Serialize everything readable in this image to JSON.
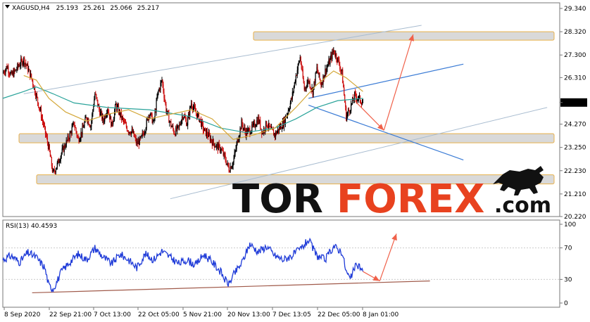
{
  "chart_data": [
    {
      "type": "candlestick",
      "header": {
        "symbol": "XAGUSD,H4",
        "open": "25.193",
        "high": "25.261",
        "low": "25.066",
        "close": "25.217"
      },
      "current_price_label": "25.217",
      "ylim": [
        20.22,
        29.34
      ],
      "y_ticks": [
        "29.340",
        "28.320",
        "27.300",
        "26.310",
        "25.217",
        "24.270",
        "23.250",
        "22.230",
        "21.210",
        "20.220"
      ],
      "x_ticks": [
        "8 Sep 2020",
        "22 Sep 21:00",
        "7 Oct 13:00",
        "22 Oct 05:00",
        "5 Nov 21:00",
        "20 Nov 13:00",
        "7 Dec 13:05",
        "22 Dec 05:00",
        "8 Jan 01:00"
      ],
      "zones": [
        {
          "low": 27.95,
          "high": 28.32
        },
        {
          "low": 23.45,
          "high": 23.85
        },
        {
          "low": 21.65,
          "high": 22.05
        }
      ],
      "price_path": [
        [
          0,
          26.5
        ],
        [
          1,
          26.8
        ],
        [
          2,
          26.4
        ],
        [
          3,
          26.6
        ],
        [
          4,
          26.9
        ],
        [
          5,
          27.1
        ],
        [
          6,
          26.7
        ],
        [
          7,
          26.2
        ],
        [
          8,
          25.5
        ],
        [
          9,
          24.8
        ],
        [
          10,
          24.0
        ],
        [
          11,
          23.2
        ],
        [
          12,
          22.1
        ],
        [
          13,
          22.5
        ],
        [
          14,
          23.0
        ],
        [
          15,
          23.4
        ],
        [
          16,
          23.8
        ],
        [
          17,
          24.3
        ],
        [
          18,
          23.6
        ],
        [
          19,
          24.0
        ],
        [
          20,
          24.6
        ],
        [
          21,
          24.2
        ],
        [
          22,
          25.6
        ],
        [
          23,
          24.9
        ],
        [
          24,
          24.4
        ],
        [
          25,
          25.0
        ],
        [
          26,
          24.2
        ],
        [
          27,
          25.1
        ],
        [
          28,
          24.7
        ],
        [
          29,
          24.3
        ],
        [
          30,
          24.0
        ],
        [
          31,
          23.9
        ],
        [
          32,
          23.4
        ],
        [
          33,
          23.6
        ],
        [
          34,
          24.1
        ],
        [
          35,
          24.8
        ],
        [
          36,
          24.3
        ],
        [
          37,
          25.6
        ],
        [
          38,
          26.2
        ],
        [
          39,
          24.9
        ],
        [
          40,
          24.3
        ],
        [
          41,
          23.9
        ],
        [
          42,
          24.1
        ],
        [
          43,
          24.7
        ],
        [
          44,
          24.3
        ],
        [
          45,
          25.2
        ],
        [
          46,
          24.8
        ],
        [
          47,
          24.5
        ],
        [
          48,
          24.0
        ],
        [
          49,
          23.8
        ],
        [
          50,
          23.5
        ],
        [
          51,
          23.3
        ],
        [
          52,
          23.2
        ],
        [
          53,
          22.8
        ],
        [
          54,
          22.3
        ],
        [
          55,
          22.6
        ],
        [
          56,
          23.5
        ],
        [
          57,
          24.3
        ],
        [
          58,
          23.9
        ],
        [
          59,
          24.0
        ],
        [
          60,
          24.2
        ],
        [
          61,
          24.5
        ],
        [
          62,
          23.9
        ],
        [
          63,
          24.3
        ],
        [
          64,
          24.0
        ],
        [
          65,
          23.8
        ],
        [
          66,
          24.1
        ],
        [
          67,
          24.3
        ],
        [
          68,
          24.8
        ],
        [
          69,
          25.4
        ],
        [
          70,
          26.4
        ],
        [
          71,
          27.2
        ],
        [
          72,
          25.8
        ],
        [
          73,
          26.2
        ],
        [
          74,
          25.7
        ],
        [
          75,
          26.7
        ],
        [
          76,
          26.0
        ],
        [
          77,
          26.6
        ],
        [
          78,
          27.0
        ],
        [
          79,
          27.5
        ],
        [
          80,
          27.1
        ],
        [
          81,
          26.5
        ],
        [
          82,
          24.6
        ],
        [
          83,
          25.0
        ],
        [
          84,
          25.5
        ],
        [
          85,
          25.4
        ],
        [
          86,
          25.2
        ]
      ],
      "ma_slow": [
        [
          0,
          25.4
        ],
        [
          5,
          25.7
        ],
        [
          8,
          25.9
        ],
        [
          12,
          25.6
        ],
        [
          17,
          25.2
        ],
        [
          25,
          25.0
        ],
        [
          35,
          24.9
        ],
        [
          45,
          24.6
        ],
        [
          52,
          24.1
        ],
        [
          58,
          23.9
        ],
        [
          65,
          24.1
        ],
        [
          70,
          24.5
        ],
        [
          75,
          25.0
        ],
        [
          80,
          25.3
        ],
        [
          86,
          25.4
        ]
      ],
      "ma_fast": [
        [
          5,
          26.4
        ],
        [
          8,
          26.2
        ],
        [
          11,
          25.4
        ],
        [
          15,
          24.8
        ],
        [
          20,
          24.4
        ],
        [
          25,
          24.7
        ],
        [
          30,
          24.9
        ],
        [
          35,
          24.5
        ],
        [
          40,
          24.7
        ],
        [
          45,
          24.9
        ],
        [
          50,
          24.5
        ],
        [
          55,
          23.6
        ],
        [
          60,
          23.8
        ],
        [
          65,
          24.1
        ],
        [
          70,
          25.0
        ],
        [
          75,
          26.0
        ],
        [
          79,
          26.6
        ],
        [
          82,
          26.3
        ],
        [
          86,
          25.7
        ]
      ],
      "trend_lines": [
        {
          "p1": [
            5,
            25.6
          ],
          "p2": [
            100,
            28.6
          ]
        },
        {
          "p1": [
            40,
            21.0
          ],
          "p2": [
            130,
            25.0
          ]
        },
        {
          "p1": [
            73,
            25.4
          ],
          "p2": [
            110,
            26.9
          ]
        },
        {
          "p1": [
            73,
            25.1
          ],
          "p2": [
            110,
            22.7
          ]
        }
      ],
      "forecast_arrows": [
        {
          "from": [
            84,
            25.3
          ],
          "to": [
            91,
            24.0
          ]
        },
        {
          "from": [
            91,
            24.0
          ],
          "to": [
            98,
            28.2
          ]
        }
      ],
      "x_range": [
        0,
        133
      ]
    },
    {
      "type": "line",
      "title": "RSI(13) 40.4593",
      "ylim": [
        0,
        100
      ],
      "y_ticks": [
        "100",
        "70",
        "30",
        "0"
      ],
      "rsi": [
        [
          0,
          55
        ],
        [
          2,
          60
        ],
        [
          4,
          52
        ],
        [
          6,
          64
        ],
        [
          8,
          58
        ],
        [
          10,
          45
        ],
        [
          11,
          22
        ],
        [
          12,
          18
        ],
        [
          13,
          28
        ],
        [
          14,
          40
        ],
        [
          16,
          52
        ],
        [
          18,
          62
        ],
        [
          20,
          55
        ],
        [
          22,
          70
        ],
        [
          24,
          58
        ],
        [
          26,
          50
        ],
        [
          28,
          62
        ],
        [
          30,
          55
        ],
        [
          32,
          45
        ],
        [
          34,
          62
        ],
        [
          36,
          55
        ],
        [
          38,
          66
        ],
        [
          40,
          58
        ],
        [
          42,
          50
        ],
        [
          44,
          55
        ],
        [
          46,
          48
        ],
        [
          48,
          62
        ],
        [
          50,
          52
        ],
        [
          52,
          40
        ],
        [
          53,
          30
        ],
        [
          54,
          24
        ],
        [
          55,
          35
        ],
        [
          57,
          50
        ],
        [
          59,
          75
        ],
        [
          61,
          65
        ],
        [
          63,
          72
        ],
        [
          65,
          60
        ],
        [
          67,
          55
        ],
        [
          69,
          60
        ],
        [
          71,
          68
        ],
        [
          73,
          80
        ],
        [
          75,
          60
        ],
        [
          77,
          55
        ],
        [
          79,
          72
        ],
        [
          81,
          65
        ],
        [
          82,
          40
        ],
        [
          83,
          30
        ],
        [
          84,
          45
        ],
        [
          85,
          48
        ],
        [
          86,
          40
        ]
      ],
      "trend_line": {
        "p1": [
          7,
          13
        ],
        "p2": [
          102,
          28
        ]
      },
      "forecast_arrows": [
        {
          "from": [
            86,
            40
          ],
          "to": [
            90,
            28
          ]
        },
        {
          "from": [
            90,
            28
          ],
          "to": [
            94,
            88
          ]
        }
      ]
    }
  ],
  "watermark": {
    "left": "TOR",
    "right": "FOREX",
    "suffix": ".com"
  }
}
